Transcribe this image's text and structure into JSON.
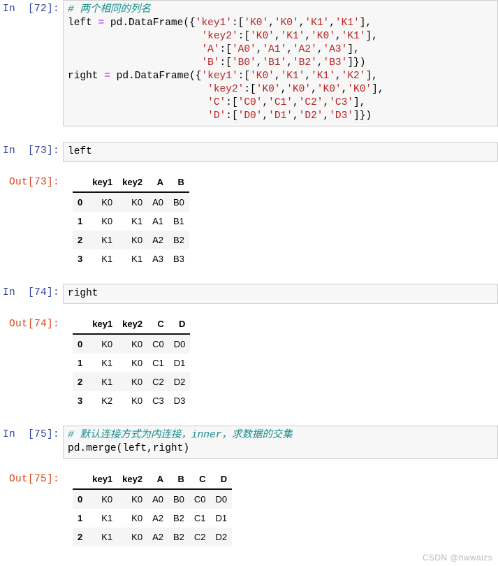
{
  "notebook": {
    "cells": [
      {
        "id": "cell-72",
        "type": "code",
        "in_prompt": "In  [72]:",
        "code_lines": [
          [
            {
              "t": "comment",
              "s": "# 两个相同的列名"
            }
          ],
          [
            {
              "t": "plain",
              "s": "left "
            },
            {
              "t": "op",
              "s": "="
            },
            {
              "t": "plain",
              "s": " pd.DataFrame({"
            },
            {
              "t": "str",
              "s": "'key1'"
            },
            {
              "t": "plain",
              "s": ":["
            },
            {
              "t": "str",
              "s": "'K0'"
            },
            {
              "t": "plain",
              "s": ","
            },
            {
              "t": "str",
              "s": "'K0'"
            },
            {
              "t": "plain",
              "s": ","
            },
            {
              "t": "str",
              "s": "'K1'"
            },
            {
              "t": "plain",
              "s": ","
            },
            {
              "t": "str",
              "s": "'K1'"
            },
            {
              "t": "plain",
              "s": "],"
            }
          ],
          [
            {
              "t": "plain",
              "s": "                      "
            },
            {
              "t": "str",
              "s": "'key2'"
            },
            {
              "t": "plain",
              "s": ":["
            },
            {
              "t": "str",
              "s": "'K0'"
            },
            {
              "t": "plain",
              "s": ","
            },
            {
              "t": "str",
              "s": "'K1'"
            },
            {
              "t": "plain",
              "s": ","
            },
            {
              "t": "str",
              "s": "'K0'"
            },
            {
              "t": "plain",
              "s": ","
            },
            {
              "t": "str",
              "s": "'K1'"
            },
            {
              "t": "plain",
              "s": "],"
            }
          ],
          [
            {
              "t": "plain",
              "s": "                      "
            },
            {
              "t": "str",
              "s": "'A'"
            },
            {
              "t": "plain",
              "s": ":["
            },
            {
              "t": "str",
              "s": "'A0'"
            },
            {
              "t": "plain",
              "s": ","
            },
            {
              "t": "str",
              "s": "'A1'"
            },
            {
              "t": "plain",
              "s": ","
            },
            {
              "t": "str",
              "s": "'A2'"
            },
            {
              "t": "plain",
              "s": ","
            },
            {
              "t": "str",
              "s": "'A3'"
            },
            {
              "t": "plain",
              "s": "],"
            }
          ],
          [
            {
              "t": "plain",
              "s": "                      "
            },
            {
              "t": "str",
              "s": "'B'"
            },
            {
              "t": "plain",
              "s": ":["
            },
            {
              "t": "str",
              "s": "'B0'"
            },
            {
              "t": "plain",
              "s": ","
            },
            {
              "t": "str",
              "s": "'B1'"
            },
            {
              "t": "plain",
              "s": ","
            },
            {
              "t": "str",
              "s": "'B2'"
            },
            {
              "t": "plain",
              "s": ","
            },
            {
              "t": "str",
              "s": "'B3'"
            },
            {
              "t": "plain",
              "s": "]})"
            }
          ],
          [
            {
              "t": "plain",
              "s": "right "
            },
            {
              "t": "op",
              "s": "="
            },
            {
              "t": "plain",
              "s": " pd.DataFrame({"
            },
            {
              "t": "str",
              "s": "'key1'"
            },
            {
              "t": "plain",
              "s": ":["
            },
            {
              "t": "str",
              "s": "'K0'"
            },
            {
              "t": "plain",
              "s": ","
            },
            {
              "t": "str",
              "s": "'K1'"
            },
            {
              "t": "plain",
              "s": ","
            },
            {
              "t": "str",
              "s": "'K1'"
            },
            {
              "t": "plain",
              "s": ","
            },
            {
              "t": "str",
              "s": "'K2'"
            },
            {
              "t": "plain",
              "s": "],"
            }
          ],
          [
            {
              "t": "plain",
              "s": "                       "
            },
            {
              "t": "str",
              "s": "'key2'"
            },
            {
              "t": "plain",
              "s": ":["
            },
            {
              "t": "str",
              "s": "'K0'"
            },
            {
              "t": "plain",
              "s": ","
            },
            {
              "t": "str",
              "s": "'K0'"
            },
            {
              "t": "plain",
              "s": ","
            },
            {
              "t": "str",
              "s": "'K0'"
            },
            {
              "t": "plain",
              "s": ","
            },
            {
              "t": "str",
              "s": "'K0'"
            },
            {
              "t": "plain",
              "s": "],"
            }
          ],
          [
            {
              "t": "plain",
              "s": "                       "
            },
            {
              "t": "str",
              "s": "'C'"
            },
            {
              "t": "plain",
              "s": ":["
            },
            {
              "t": "str",
              "s": "'C0'"
            },
            {
              "t": "plain",
              "s": ","
            },
            {
              "t": "str",
              "s": "'C1'"
            },
            {
              "t": "plain",
              "s": ","
            },
            {
              "t": "str",
              "s": "'C2'"
            },
            {
              "t": "plain",
              "s": ","
            },
            {
              "t": "str",
              "s": "'C3'"
            },
            {
              "t": "plain",
              "s": "],"
            }
          ],
          [
            {
              "t": "plain",
              "s": "                       "
            },
            {
              "t": "str",
              "s": "'D'"
            },
            {
              "t": "plain",
              "s": ":["
            },
            {
              "t": "str",
              "s": "'D0'"
            },
            {
              "t": "plain",
              "s": ","
            },
            {
              "t": "str",
              "s": "'D1'"
            },
            {
              "t": "plain",
              "s": ","
            },
            {
              "t": "str",
              "s": "'D2'"
            },
            {
              "t": "plain",
              "s": ","
            },
            {
              "t": "str",
              "s": "'D3'"
            },
            {
              "t": "plain",
              "s": "]})"
            }
          ]
        ]
      },
      {
        "id": "cell-73",
        "type": "code",
        "in_prompt": "In  [73]:",
        "code_lines": [
          [
            {
              "t": "plain",
              "s": "left"
            }
          ]
        ],
        "out_prompt": "Out[73]:",
        "table": {
          "index_header": "",
          "columns": [
            "key1",
            "key2",
            "A",
            "B"
          ],
          "index": [
            "0",
            "1",
            "2",
            "3"
          ],
          "rows": [
            [
              "K0",
              "K0",
              "A0",
              "B0"
            ],
            [
              "K0",
              "K1",
              "A1",
              "B1"
            ],
            [
              "K1",
              "K0",
              "A2",
              "B2"
            ],
            [
              "K1",
              "K1",
              "A3",
              "B3"
            ]
          ]
        }
      },
      {
        "id": "cell-74",
        "type": "code",
        "in_prompt": "In  [74]:",
        "code_lines": [
          [
            {
              "t": "plain",
              "s": "right"
            }
          ]
        ],
        "out_prompt": "Out[74]:",
        "table": {
          "index_header": "",
          "columns": [
            "key1",
            "key2",
            "C",
            "D"
          ],
          "index": [
            "0",
            "1",
            "2",
            "3"
          ],
          "rows": [
            [
              "K0",
              "K0",
              "C0",
              "D0"
            ],
            [
              "K1",
              "K0",
              "C1",
              "D1"
            ],
            [
              "K1",
              "K0",
              "C2",
              "D2"
            ],
            [
              "K2",
              "K0",
              "C3",
              "D3"
            ]
          ]
        }
      },
      {
        "id": "cell-75",
        "type": "code",
        "in_prompt": "In  [75]:",
        "code_lines": [
          [
            {
              "t": "comment",
              "s": "# 默认连接方式为内连接，inner，求数据的交集"
            }
          ],
          [
            {
              "t": "plain",
              "s": "pd.merge(left,right)"
            }
          ]
        ],
        "out_prompt": "Out[75]:",
        "table": {
          "index_header": "",
          "columns": [
            "key1",
            "key2",
            "A",
            "B",
            "C",
            "D"
          ],
          "index": [
            "0",
            "1",
            "2"
          ],
          "rows": [
            [
              "K0",
              "K0",
              "A0",
              "B0",
              "C0",
              "D0"
            ],
            [
              "K1",
              "K0",
              "A2",
              "B2",
              "C1",
              "D1"
            ],
            [
              "K1",
              "K0",
              "A2",
              "B2",
              "C2",
              "D2"
            ]
          ]
        }
      }
    ]
  },
  "watermark": {
    "text": "CSDN @hwwaizs"
  },
  "colors": {
    "prompt_in": "#303F9F",
    "prompt_out": "#D84315",
    "comment": "#178C8C",
    "string": "#BA2121",
    "operator": "#AA22FF",
    "cell_background": "#F7F7F7",
    "cell_border": "#CFCFCF",
    "row_stripe": "#F5F5F5",
    "watermark": "#B9B9B9"
  }
}
